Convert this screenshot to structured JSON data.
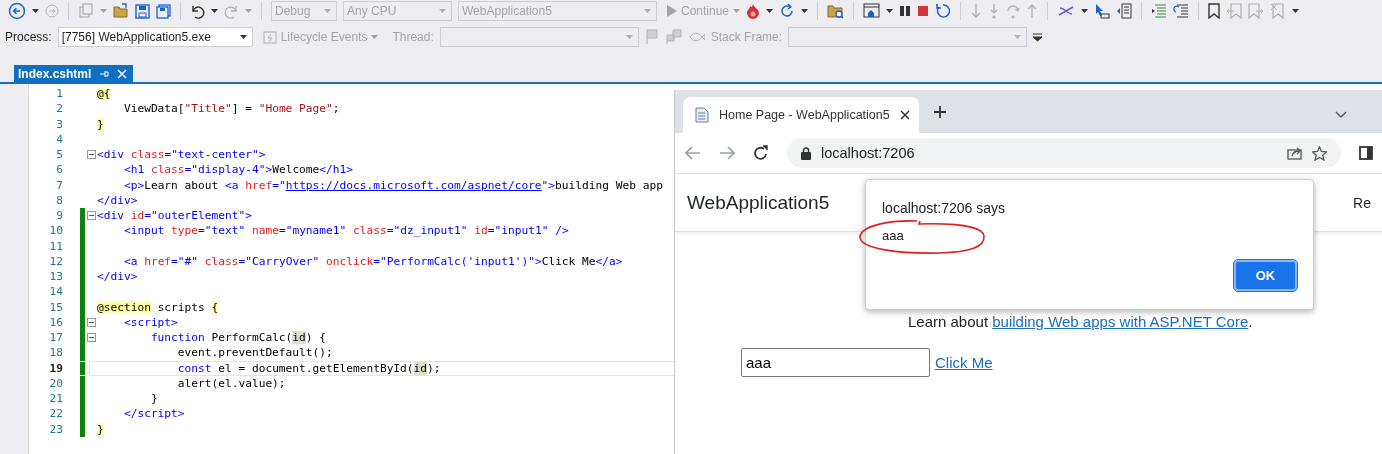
{
  "toolbar": {
    "configuration": {
      "value": "Debug",
      "disabled": true
    },
    "platform": {
      "value": "Any CPU",
      "disabled": true
    },
    "startup": {
      "value": "WebApplication5",
      "disabled": true
    },
    "continue": {
      "label": "Continue",
      "disabled": true
    },
    "process_label": "Process:",
    "process": {
      "value": "[7756] WebApplication5.exe",
      "disabled": false
    },
    "lifecycle": {
      "label": "Lifecycle Events",
      "disabled": true
    },
    "thread_label": {
      "text": "Thread:",
      "disabled": true
    },
    "thread": {
      "disabled": true
    },
    "stack_frame_label": {
      "text": "Stack Frame:",
      "disabled": true
    },
    "stack_frame": {
      "disabled": true
    }
  },
  "document_tab": {
    "title": "Index.cshtml",
    "selected": true
  },
  "editor": {
    "lines": [
      {
        "n": "1",
        "fold": false,
        "changed": false,
        "current": false,
        "tokens": [
          {
            "kind": "razor",
            "text": "@{"
          }
        ]
      },
      {
        "n": "2",
        "fold": false,
        "changed": false,
        "current": false,
        "tokens": [
          {
            "kind": "plain",
            "text": "    ViewData["
          },
          {
            "kind": "str",
            "text": "\"Title\""
          },
          {
            "kind": "plain",
            "text": "] = "
          },
          {
            "kind": "str",
            "text": "\"Home Page\""
          },
          {
            "kind": "plain",
            "text": ";"
          }
        ]
      },
      {
        "n": "3",
        "fold": false,
        "changed": false,
        "current": false,
        "tokens": [
          {
            "kind": "razor",
            "text": "}"
          }
        ]
      },
      {
        "n": "4",
        "fold": false,
        "changed": false,
        "current": false
      },
      {
        "n": "5",
        "fold": true,
        "changed": false,
        "current": false,
        "tokens": [
          {
            "kind": "tag",
            "text": "<div"
          },
          {
            "kind": "attr",
            "text": " class"
          },
          {
            "kind": "tag",
            "text": "="
          },
          {
            "kind": "val",
            "text": "\"text-center\""
          },
          {
            "kind": "tag",
            "text": ">"
          }
        ]
      },
      {
        "n": "6",
        "fold": false,
        "changed": false,
        "current": false,
        "tokens": [
          {
            "kind": "tag",
            "text": "    <h1"
          },
          {
            "kind": "attr",
            "text": " class"
          },
          {
            "kind": "tag",
            "text": "="
          },
          {
            "kind": "val",
            "text": "\"display-4\""
          },
          {
            "kind": "tag",
            "text": ">"
          },
          {
            "kind": "plain",
            "text": "Welcome"
          },
          {
            "kind": "tag",
            "text": "</h1>"
          }
        ]
      },
      {
        "n": "7",
        "fold": false,
        "changed": false,
        "current": false,
        "tokens": [
          {
            "kind": "tag",
            "text": "    <p>"
          },
          {
            "kind": "plain",
            "text": "Learn about "
          },
          {
            "kind": "tag",
            "text": "<a"
          },
          {
            "kind": "attr",
            "text": " href"
          },
          {
            "kind": "tag",
            "text": "="
          },
          {
            "kind": "val",
            "text": "\""
          },
          {
            "kind": "url",
            "text": "https://docs.microsoft.com/aspnet/core"
          },
          {
            "kind": "val",
            "text": "\""
          },
          {
            "kind": "tag",
            "text": ">"
          },
          {
            "kind": "plain",
            "text": "building Web app"
          }
        ]
      },
      {
        "n": "8",
        "fold": false,
        "changed": false,
        "current": false,
        "tokens": [
          {
            "kind": "tag",
            "text": "</div>"
          }
        ]
      },
      {
        "n": "9",
        "fold": true,
        "changed": true,
        "current": false,
        "tokens": [
          {
            "kind": "tag",
            "text": "<div"
          },
          {
            "kind": "attr",
            "text": " id"
          },
          {
            "kind": "tag",
            "text": "="
          },
          {
            "kind": "val",
            "text": "\"outerElement\""
          },
          {
            "kind": "tag",
            "text": ">"
          }
        ]
      },
      {
        "n": "10",
        "fold": false,
        "changed": true,
        "current": false,
        "tokens": [
          {
            "kind": "tag",
            "text": "    <input"
          },
          {
            "kind": "attr",
            "text": " type"
          },
          {
            "kind": "tag",
            "text": "="
          },
          {
            "kind": "val",
            "text": "\"text\""
          },
          {
            "kind": "attr",
            "text": " name"
          },
          {
            "kind": "tag",
            "text": "="
          },
          {
            "kind": "val",
            "text": "\"myname1\""
          },
          {
            "kind": "attr",
            "text": " class"
          },
          {
            "kind": "tag",
            "text": "="
          },
          {
            "kind": "val",
            "text": "\"dz_input1\""
          },
          {
            "kind": "attr",
            "text": " id"
          },
          {
            "kind": "tag",
            "text": "="
          },
          {
            "kind": "val",
            "text": "\"input1\""
          },
          {
            "kind": "tag",
            "text": " />"
          }
        ]
      },
      {
        "n": "11",
        "fold": false,
        "changed": true,
        "current": false
      },
      {
        "n": "12",
        "fold": false,
        "changed": true,
        "current": false,
        "tokens": [
          {
            "kind": "tag",
            "text": "    <a"
          },
          {
            "kind": "attr",
            "text": " href"
          },
          {
            "kind": "tag",
            "text": "="
          },
          {
            "kind": "val",
            "text": "\"#\""
          },
          {
            "kind": "attr",
            "text": " class"
          },
          {
            "kind": "tag",
            "text": "="
          },
          {
            "kind": "val",
            "text": "\"CarryOver\""
          },
          {
            "kind": "attr",
            "text": " onclick"
          },
          {
            "kind": "tag",
            "text": "="
          },
          {
            "kind": "val",
            "text": "\"PerformCalc('input1')\""
          },
          {
            "kind": "tag",
            "text": ">"
          },
          {
            "kind": "plain",
            "text": "Click Me"
          },
          {
            "kind": "tag",
            "text": "</a>"
          }
        ]
      },
      {
        "n": "13",
        "fold": false,
        "changed": true,
        "current": false,
        "tokens": [
          {
            "kind": "tag",
            "text": "</div>"
          }
        ]
      },
      {
        "n": "14",
        "fold": false,
        "changed": true,
        "current": false
      },
      {
        "n": "15",
        "fold": false,
        "changed": true,
        "current": false,
        "tokens": [
          {
            "kind": "razor",
            "text": "@section"
          },
          {
            "kind": "plain",
            "text": " scripts "
          },
          {
            "kind": "razor",
            "text": "{"
          }
        ]
      },
      {
        "n": "16",
        "fold": true,
        "changed": true,
        "current": false,
        "tokens": [
          {
            "kind": "tag",
            "text": "    <script>"
          }
        ]
      },
      {
        "n": "17",
        "fold": true,
        "changed": true,
        "current": false,
        "tokens": [
          {
            "kind": "kw",
            "text": "        function"
          },
          {
            "kind": "plain",
            "text": " PerformCalc("
          },
          {
            "kind": "ref",
            "text": "id"
          },
          {
            "kind": "plain",
            "text": ") {"
          }
        ]
      },
      {
        "n": "18",
        "fold": false,
        "changed": true,
        "current": false,
        "tokens": [
          {
            "kind": "plain",
            "text": "            event.preventDefault();"
          }
        ]
      },
      {
        "n": "19",
        "fold": false,
        "changed": true,
        "current": true,
        "tokens": [
          {
            "kind": "kw",
            "text": "            const"
          },
          {
            "kind": "plain",
            "text": " el = document.getElementById("
          },
          {
            "kind": "ref",
            "text": "id"
          },
          {
            "kind": "plain",
            "text": ");"
          }
        ]
      },
      {
        "n": "20",
        "fold": false,
        "changed": true,
        "current": false,
        "tokens": [
          {
            "kind": "plain",
            "text": "            alert(el.value);"
          }
        ]
      },
      {
        "n": "21",
        "fold": false,
        "changed": true,
        "current": false,
        "tokens": [
          {
            "kind": "plain",
            "text": "        }"
          }
        ]
      },
      {
        "n": "22",
        "fold": false,
        "changed": true,
        "current": false,
        "tokens": [
          {
            "kind": "tag",
            "text": "    </script>"
          }
        ]
      },
      {
        "n": "23",
        "fold": false,
        "changed": true,
        "current": false,
        "tokens": [
          {
            "kind": "razor",
            "text": "}"
          }
        ]
      }
    ]
  },
  "browser": {
    "tab": {
      "title": "Home Page - WebApplication5",
      "selected": true
    },
    "address": "localhost:7206",
    "navbar": {
      "brand": "WebApplication5",
      "link_cut": "Re"
    },
    "dialog": {
      "title": "localhost:7206 says",
      "message": "aaa",
      "button": "OK",
      "annotated": true
    },
    "intro": {
      "before": "Learn about ",
      "link": "building Web apps with ASP.NET Core",
      "after": "."
    },
    "form": {
      "input_value": "aaa",
      "link": "Click Me"
    }
  }
}
